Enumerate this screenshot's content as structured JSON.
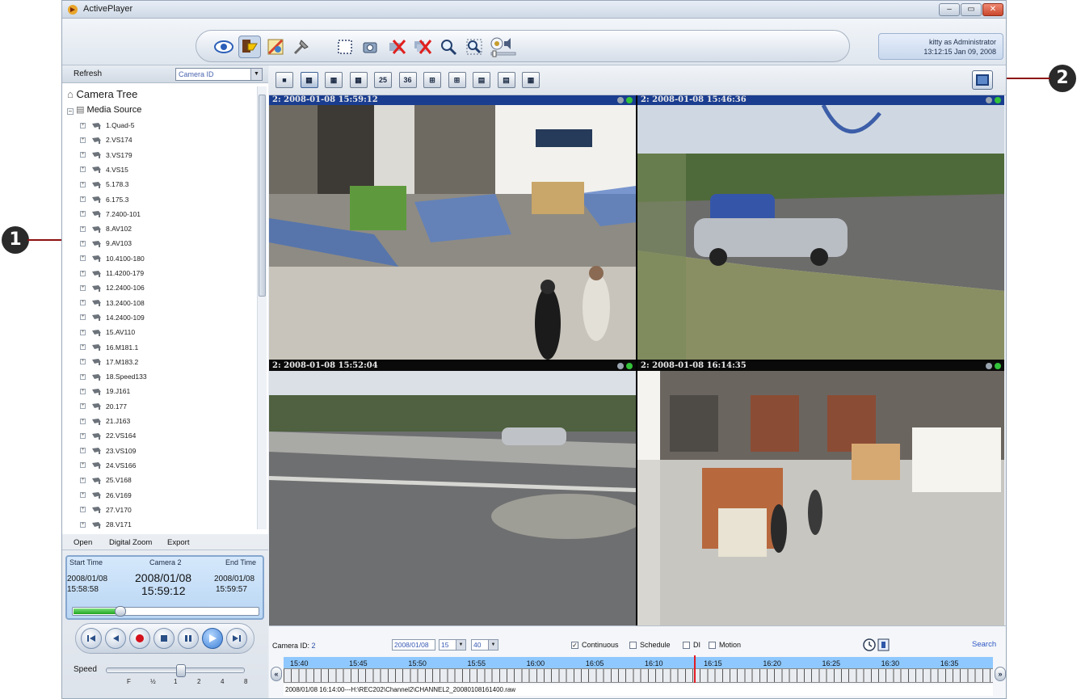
{
  "window": {
    "title": "ActivePlayer",
    "buttons": [
      "minimize",
      "maximize",
      "close"
    ]
  },
  "user": {
    "line1": "kitty as Administrator",
    "line2": "13:12:15 Jan 09, 2008"
  },
  "toolbar": {
    "icons": [
      "eye-icon",
      "export-icon",
      "settings-icon",
      "tools-icon",
      "fit-icon",
      "snapshot-icon",
      "disconnect-icon",
      "disconnect-all-icon",
      "zoom-icon",
      "zoom-region-icon",
      "audio-icon"
    ]
  },
  "left": {
    "refresh": "Refresh",
    "camera_select": "Camera ID",
    "tree_title": "Camera Tree",
    "media_source": "Media Source",
    "items": [
      "1.Quad-5",
      "2.VS174",
      "3.VS179",
      "4.VS15",
      "5.178.3",
      "6.175.3",
      "7.2400-101",
      "8.AV102",
      "9.AV103",
      "10.4100-180",
      "11.4200-179",
      "12.2400-106",
      "13.2400-108",
      "14.2400-109",
      "15.AV110",
      "16.M181.1",
      "17.M183.2",
      "18.Speed133",
      "19.J161",
      "20.177",
      "21.J163",
      "22.VS164",
      "23.VS109",
      "24.VS166",
      "25.V168",
      "26.V169",
      "27.V170",
      "28.V171"
    ],
    "actions": {
      "open": "Open",
      "digital_zoom": "Digital Zoom",
      "export": "Export"
    },
    "time": {
      "start_label": "Start Time",
      "camera_label": "Camera 2",
      "end_label": "End Time",
      "start_date": "2008/01/08",
      "start_time": "15:58:58",
      "current_date": "2008/01/08",
      "current_time": "15:59:12",
      "end_date": "2008/01/08",
      "end_time": "15:59:57",
      "progress": 0.25
    },
    "speed": {
      "label": "Speed",
      "ticks": [
        "F",
        "½",
        "1",
        "2",
        "4",
        "8"
      ],
      "selected": "1"
    }
  },
  "layouts": [
    "1x1",
    "2x2",
    "3x3",
    "4x4",
    "25",
    "36",
    "1+5",
    "1+7",
    "1+12",
    "2+8",
    "1+9"
  ],
  "panes": [
    {
      "title": "2:  2008-01-08 15:59:12",
      "selected": true
    },
    {
      "title": "2:  2008-01-08 15:46:36",
      "selected": true
    },
    {
      "title": "2:  2008-01-08 15:52:04",
      "selected": false
    },
    {
      "title": "2:  2008-01-08 16:14:35",
      "selected": false
    }
  ],
  "search": {
    "camera_id_label": "Camera ID:",
    "camera_id_value": "2",
    "date": "2008/01/08",
    "hour": "15",
    "minute": "40",
    "continuous": "Continuous",
    "schedule": "Schedule",
    "di": "DI",
    "motion": "Motion",
    "search_button": "Search"
  },
  "timeline": {
    "labels": [
      "15:40",
      "15:45",
      "15:50",
      "15:55",
      "16:00",
      "16:05",
      "16:10",
      "16:15",
      "16:20",
      "16:25",
      "16:30",
      "16:35"
    ],
    "left_arrow": "«",
    "right_arrow": "»",
    "file": "2008/01/08 16:14:00---H:\\REC202\\Channel2\\CHANNEL2_20080108161400.raw"
  },
  "callouts": [
    "1",
    "2"
  ],
  "colors": {
    "accent": "#1a3d8f",
    "cursor": "#e31b23",
    "timeline": "#8ec8ff"
  }
}
